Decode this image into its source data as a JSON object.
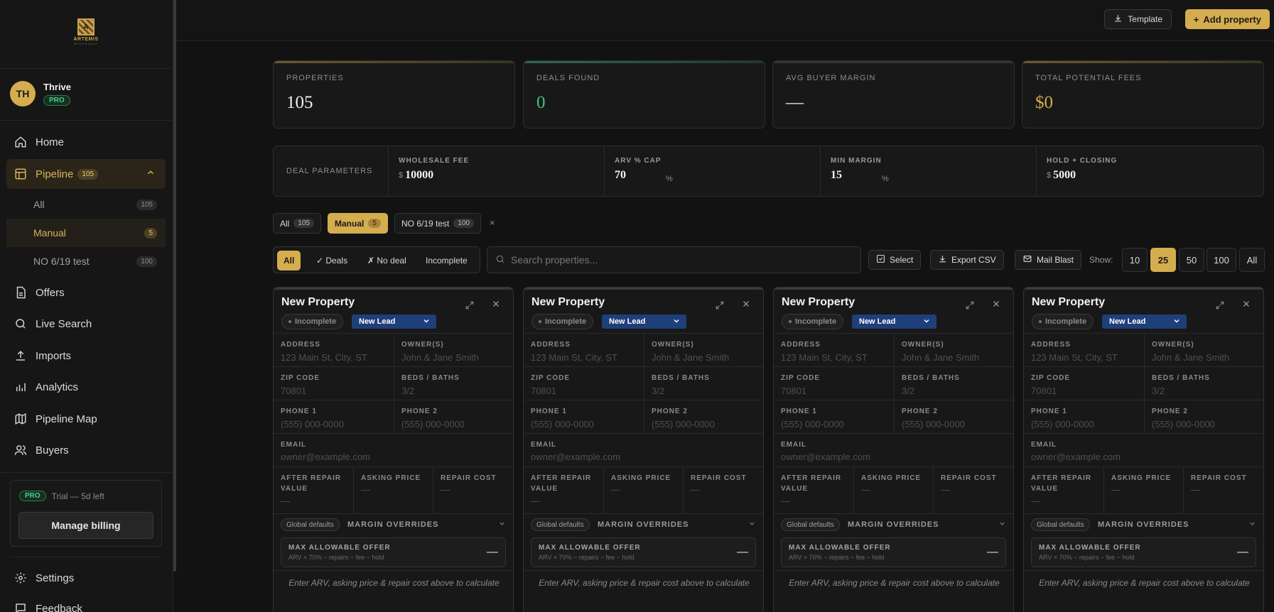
{
  "brand": {
    "logo_text": "ARTEMIS",
    "logo_sub": "WHOLESALE"
  },
  "user": {
    "initials": "TH",
    "name": "Thrive",
    "plan": "PRO"
  },
  "nav": {
    "home": "Home",
    "pipeline": {
      "label": "Pipeline",
      "count": "105"
    },
    "pipeline_sub": [
      {
        "label": "All",
        "count": "105"
      },
      {
        "label": "Manual",
        "count": "5"
      },
      {
        "label": "NO 6/19 test",
        "count": "100"
      }
    ],
    "offers": "Offers",
    "live_search": "Live Search",
    "imports": "Imports",
    "analytics": "Analytics",
    "pipeline_map": "Pipeline Map",
    "buyers": "Buyers",
    "settings": "Settings",
    "feedback": "Feedback"
  },
  "trial": {
    "plan": "PRO",
    "text": "Trial — 5d left",
    "billing": "Manage billing"
  },
  "topbar": {
    "template": "Template",
    "add": "Add property"
  },
  "stats": [
    {
      "label": "PROPERTIES",
      "value": "105"
    },
    {
      "label": "DEALS FOUND",
      "value": "0"
    },
    {
      "label": "AVG BUYER MARGIN",
      "value": "—"
    },
    {
      "label": "TOTAL POTENTIAL FEES",
      "value": "$0"
    }
  ],
  "params": {
    "title": "DEAL PARAMETERS",
    "wholesale_fee": {
      "label": "WHOLESALE FEE",
      "prefix": "$",
      "value": "10000"
    },
    "arv_cap": {
      "label": "ARV % CAP",
      "value": "70",
      "suffix": "%"
    },
    "min_margin": {
      "label": "MIN MARGIN",
      "value": "15",
      "suffix": "%"
    },
    "hold_closing": {
      "label": "HOLD + CLOSING",
      "prefix": "$",
      "value": "5000"
    }
  },
  "tabs": [
    {
      "label": "All",
      "count": "105"
    },
    {
      "label": "Manual",
      "count": "5"
    },
    {
      "label": "NO 6/19 test",
      "count": "100"
    }
  ],
  "tab_close": "×",
  "filters": {
    "all": "All",
    "deals": "✓ Deals",
    "no_deal": "✗ No deal",
    "incomplete": "Incomplete"
  },
  "search": {
    "placeholder": "Search properties..."
  },
  "toolbar": {
    "select": "Select",
    "export": "Export CSV",
    "mail": "Mail Blast",
    "show": "Show:"
  },
  "page_sizes": [
    "10",
    "25",
    "50",
    "100",
    "All"
  ],
  "card": {
    "title": "New Property",
    "status": "Incomplete",
    "lead": "New Lead",
    "address": {
      "label": "ADDRESS",
      "placeholder": "123 Main St, City, ST"
    },
    "owners": {
      "label": "OWNER(S)",
      "placeholder": "John & Jane Smith"
    },
    "zip": {
      "label": "ZIP CODE",
      "placeholder": "70801"
    },
    "beds": {
      "label": "BEDS / BATHS",
      "placeholder": "3/2"
    },
    "phone1": {
      "label": "PHONE 1",
      "placeholder": "(555) 000-0000"
    },
    "phone2": {
      "label": "PHONE 2",
      "placeholder": "(555) 000-0000"
    },
    "email": {
      "label": "EMAIL",
      "placeholder": "owner@example.com"
    },
    "arv": {
      "label": "AFTER REPAIR VALUE",
      "placeholder": "—"
    },
    "asking": {
      "label": "ASKING PRICE",
      "placeholder": "—"
    },
    "repair": {
      "label": "REPAIR COST",
      "placeholder": "—"
    },
    "global_defaults": "Global defaults",
    "margin_overrides": "MARGIN OVERRIDES",
    "mao_label": "MAX ALLOWABLE OFFER",
    "mao_formula": "ARV × 70% − repairs − fee − hold",
    "mao_value": "—",
    "hint": "Enter ARV, asking price & repair cost above to calculate"
  },
  "colors": {
    "accent": "#d4ad4e",
    "lead": "#1f3f7a",
    "success": "#3ec487"
  }
}
